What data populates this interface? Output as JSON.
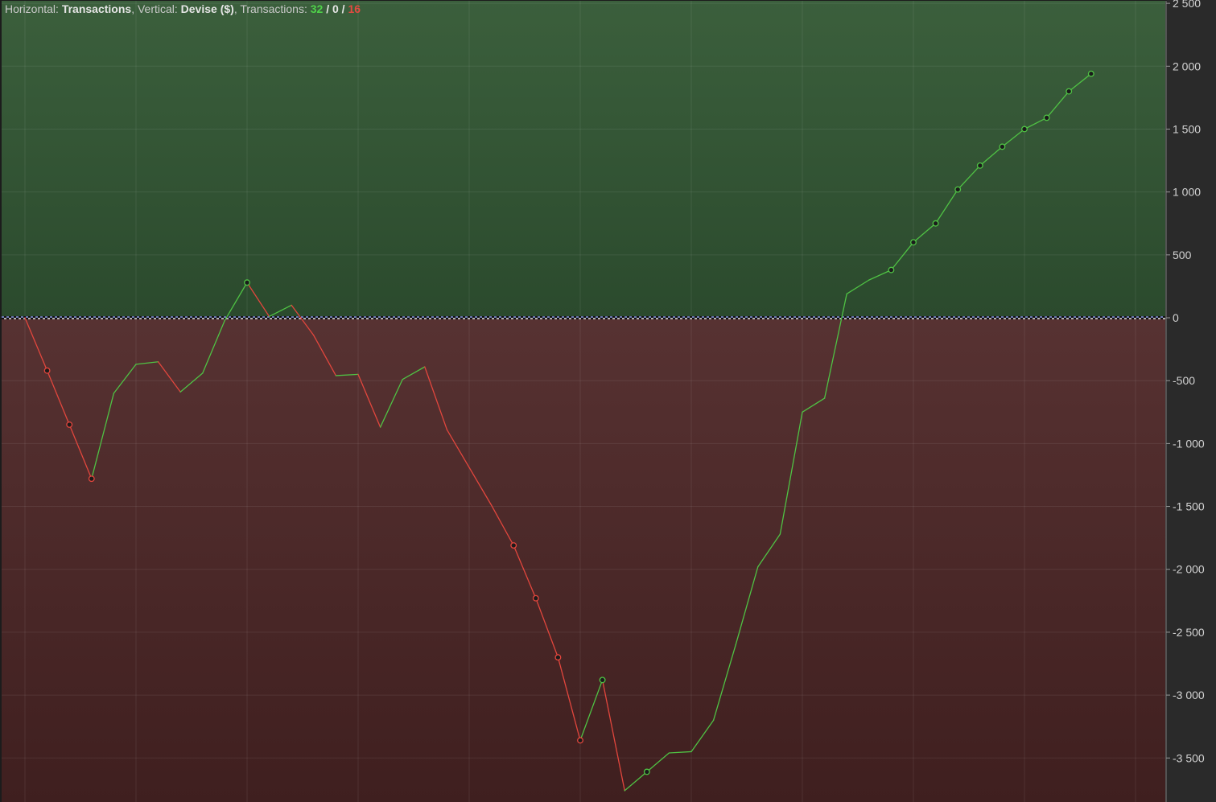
{
  "header": {
    "h_prefix": "Horizontal: ",
    "h_value": "Transactions",
    "v_prefix": ", Vertical: ",
    "v_value": "Devise ($)",
    "t_prefix": ", Transactions: ",
    "wins": "32",
    "sep1": " / ",
    "even": "0",
    "sep2": " / ",
    "losses": "16"
  },
  "colors": {
    "positive_top": "#3b5f3c",
    "positive_bottom": "#2b4a2d",
    "negative_top": "#573232",
    "negative_bottom": "#3f1f1f",
    "up_line": "#4fc244",
    "down_line": "#e2463d",
    "zero_line_a": "#9ab0ff",
    "zero_line_b": "#ffffff",
    "axis_bg": "#2a2a2a"
  },
  "chart_data": {
    "type": "line",
    "xlabel": "Transactions",
    "ylabel": "Devise ($)",
    "ylim": [
      -3850,
      2520
    ],
    "xlim": [
      0,
      52
    ],
    "yticks": [
      2500,
      2000,
      1500,
      1000,
      500,
      0,
      -500,
      -1000,
      -1500,
      -2000,
      -2500,
      -3000,
      -3500
    ],
    "ytick_labels": [
      "2 500",
      "2 000",
      "1 500",
      "1 000",
      "500",
      "0",
      "-500",
      "-1 000",
      "-1 500",
      "-2 000",
      "-2 500",
      "-3 000",
      "-3 500"
    ],
    "grid": true,
    "zero_line": true,
    "series": [
      {
        "values": [
          0,
          -420,
          -850,
          -1280,
          -600,
          -370,
          -350,
          -590,
          -440,
          -20,
          280,
          10,
          100,
          -140,
          -460,
          -450,
          -870,
          -490,
          -390,
          -890,
          -1190,
          -1490,
          -1810,
          -2230,
          -2700,
          -3360,
          -2880,
          -3760,
          -3610,
          -3460,
          -3450,
          -3200,
          -2600,
          -1980,
          -1720,
          -750,
          -640,
          190,
          300,
          380,
          600,
          750,
          1020,
          1210,
          1360,
          1500,
          1590,
          1800,
          1940
        ]
      }
    ],
    "markers": [
      1,
      2,
      3,
      10,
      22,
      23,
      24,
      25,
      26,
      28,
      39,
      40,
      41,
      42,
      43,
      44,
      45,
      46,
      47,
      48
    ]
  }
}
